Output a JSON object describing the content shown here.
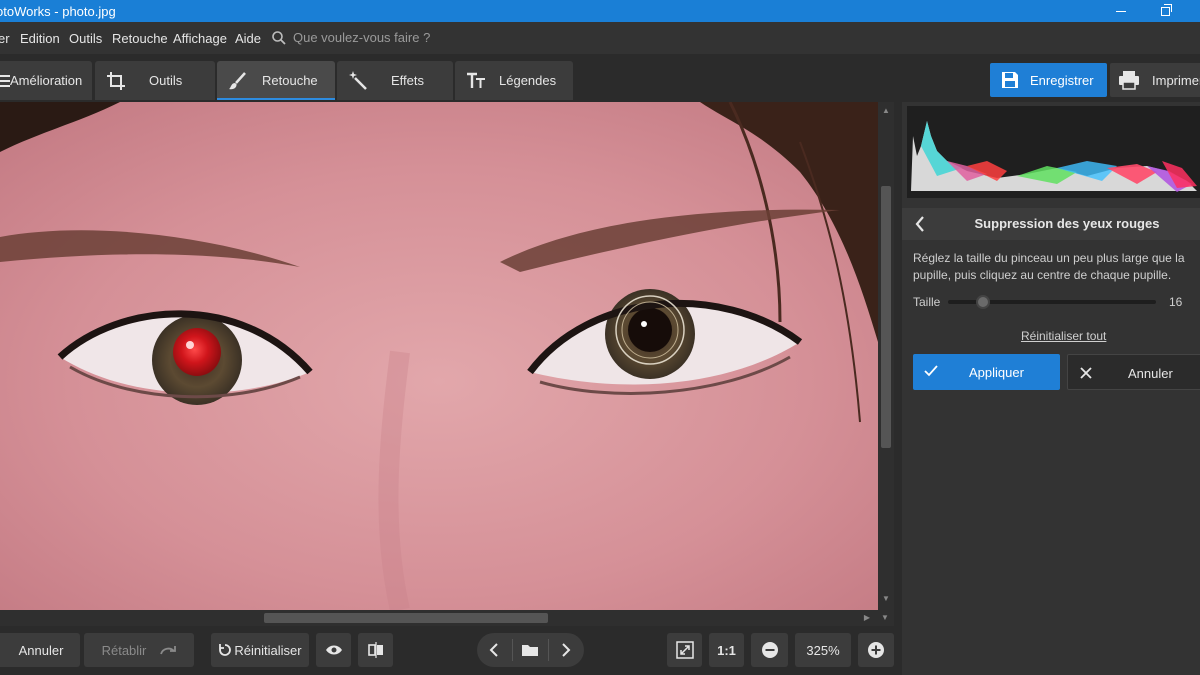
{
  "window": {
    "title": "PhotoWorks - photo.jpg",
    "title_visible": "otoWorks - photo.jpg"
  },
  "menu": {
    "items": [
      "Fichier",
      "Edition",
      "Outils",
      "Retouche",
      "Affichage",
      "Aide"
    ],
    "first_visible": "er",
    "search_placeholder": "Que voulez-vous faire ?"
  },
  "tabs": [
    {
      "label": "Amélioration",
      "icon": "enhance-icon"
    },
    {
      "label": "Outils",
      "icon": "crop-icon"
    },
    {
      "label": "Retouche",
      "icon": "brush-icon",
      "active": true
    },
    {
      "label": "Effets",
      "icon": "magic-wand-icon"
    },
    {
      "label": "Légendes",
      "icon": "text-icon"
    }
  ],
  "actions": {
    "save_label": "Enregistrer",
    "print_label": "Imprimer",
    "print_visible": "Imprimer"
  },
  "panel": {
    "title": "Suppression des yeux rouges",
    "description": "Réglez la taille du pinceau un peu plus large que la pupille, puis cliquez au centre de chaque pupille.",
    "size_label": "Taille",
    "size_value": "16",
    "size_fraction": 0.17,
    "reset_all": "Réinitialiser tout",
    "apply_label": "Appliquer",
    "cancel_label": "Annuler"
  },
  "bottom": {
    "undo": "Annuler",
    "redo": "Rétablir",
    "reset": "Réinitialiser",
    "one_to_one": "1:1",
    "zoom": "325%"
  },
  "colors": {
    "accent": "#1f7fd6",
    "titlebar": "#1a7fd6",
    "red_eye": "#c8161c"
  }
}
